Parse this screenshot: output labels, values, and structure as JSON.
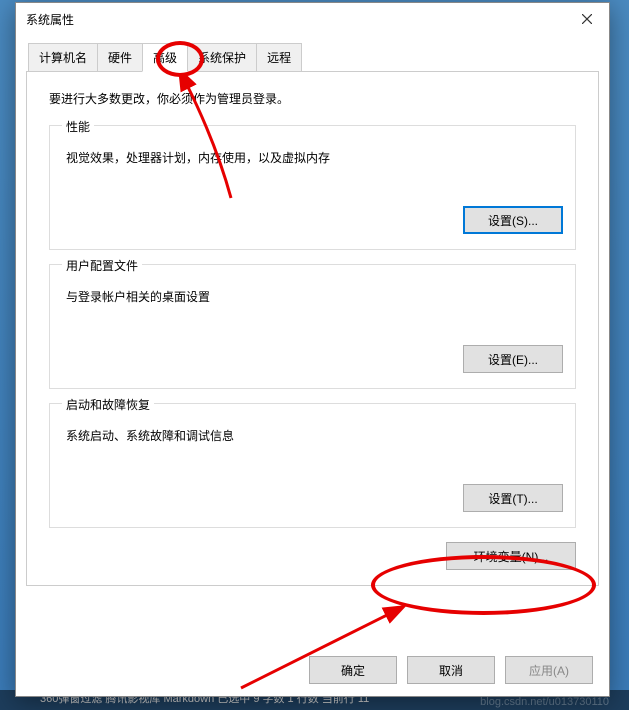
{
  "window": {
    "title": "系统属性"
  },
  "tabs": {
    "computer_name": "计算机名",
    "hardware": "硬件",
    "advanced": "高级",
    "system_protection": "系统保护",
    "remote": "远程"
  },
  "content": {
    "admin_note": "要进行大多数更改，你必须作为管理员登录。",
    "performance": {
      "title": "性能",
      "desc": "视觉效果，处理器计划，内存使用，以及虚拟内存",
      "button": "设置(S)..."
    },
    "user_profiles": {
      "title": "用户配置文件",
      "desc": "与登录帐户相关的桌面设置",
      "button": "设置(E)..."
    },
    "startup": {
      "title": "启动和故障恢复",
      "desc": "系统启动、系统故障和调试信息",
      "button": "设置(T)..."
    },
    "env_button": "环境变量(N)..."
  },
  "buttons": {
    "ok": "确定",
    "cancel": "取消",
    "apply": "应用(A)"
  },
  "backdrop": {
    "watermark": "blog.csdn.net/u013730110",
    "taskbar": "360弹窗过滤   腾讯影视库                                Markdown 已选中  9 字数  1 行数  当前行 11"
  }
}
